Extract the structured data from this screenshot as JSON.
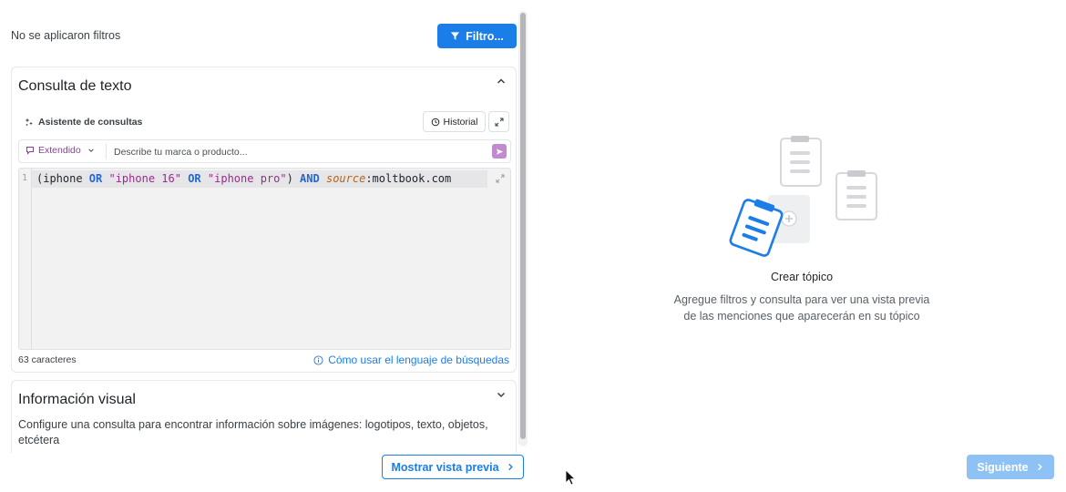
{
  "filters": {
    "status_text": "No se aplicaron filtros",
    "filter_button_label": "Filtro..."
  },
  "text_query": {
    "title": "Consulta de texto",
    "assistant_label": "Asistente de consultas",
    "history_label": "Historial",
    "mode_label": "Extendido",
    "prompt_placeholder": "Describe tu marca o producto...",
    "line_number": "1",
    "tokens": {
      "t1": "(iphone ",
      "t2": "OR",
      "t3": " ",
      "t4": "\"iphone 16\"",
      "t5": " ",
      "t6": "OR",
      "t7": " ",
      "t8": "\"iphone pro\"",
      "t9": ") ",
      "t10": "AND",
      "t11": " ",
      "t12": "source",
      "t13": ":moltbook.com"
    },
    "char_count": "63 caracteres",
    "help_link": "Cómo usar el lenguaje de búsquedas"
  },
  "visual_info": {
    "title": "Información visual",
    "description": "Configure una consulta para encontrar información sobre imágenes: logotipos, texto, objetos, etcétera"
  },
  "footer": {
    "preview_button": "Mostrar vista previa",
    "next_button": "Siguiente"
  },
  "empty_state": {
    "title": "Crear tópico",
    "description_line1": "Agregue filtros y consulta para ver una vista previa",
    "description_line2": "de las menciones que aparecerán en su tópico"
  },
  "colors": {
    "accent": "#1a7de8",
    "keyword": "#2468d1",
    "string": "#9a2b8f",
    "field": "#b5651d",
    "mode": "#8c3d9b",
    "next_disabled": "#8ec2f4"
  },
  "icons": {
    "filter": "filter-icon",
    "assistant": "sparkle-icon",
    "history": "history-icon",
    "expand": "expand-icon",
    "mode": "speech-bubble-icon",
    "send": "send-icon",
    "info": "info-icon",
    "chevron": "chevron-icon"
  }
}
